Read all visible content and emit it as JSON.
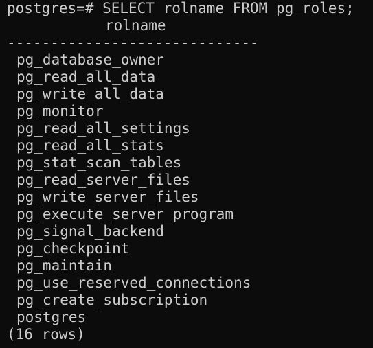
{
  "terminal": {
    "prompt": "postgres=# ",
    "command": "SELECT rolname FROM pg_roles;",
    "column_header": "rolname",
    "separator": "-----------------------------",
    "rows": [
      "pg_database_owner",
      "pg_read_all_data",
      "pg_write_all_data",
      "pg_monitor",
      "pg_read_all_settings",
      "pg_read_all_stats",
      "pg_stat_scan_tables",
      "pg_read_server_files",
      "pg_write_server_files",
      "pg_execute_server_program",
      "pg_signal_backend",
      "pg_checkpoint",
      "pg_maintain",
      "pg_use_reserved_connections",
      "pg_create_subscription",
      "postgres"
    ],
    "footer": "(16 rows)"
  },
  "colors": {
    "background": "#0c0c0c",
    "text": "#cccccc"
  }
}
